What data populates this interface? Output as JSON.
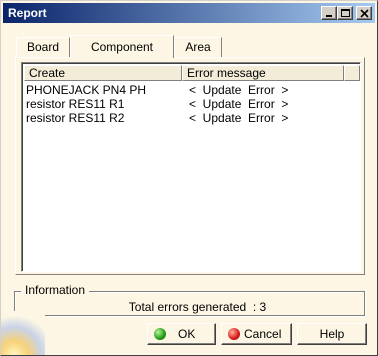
{
  "window": {
    "title": "Report",
    "controls": {
      "minimize_icon": "minimize-icon",
      "maximize_icon": "maximize-icon",
      "close_icon": "close-icon"
    }
  },
  "tabs": [
    {
      "label": "Board",
      "selected": false
    },
    {
      "label": "Component",
      "selected": true
    },
    {
      "label": "Area",
      "selected": false
    }
  ],
  "list": {
    "columns": [
      "Create",
      "Error message"
    ],
    "rows": [
      {
        "create": "PHONEJACK PN4 PH",
        "error": "<  Update  Error  >"
      },
      {
        "create": "resistor RES11 R1",
        "error": "<  Update  Error  >"
      },
      {
        "create": "resistor RES11 R2",
        "error": "<  Update  Error  >"
      }
    ]
  },
  "information": {
    "legend": "Information",
    "text": "Total errors generated  : 3"
  },
  "buttons": {
    "ok": "OK",
    "cancel": "Cancel",
    "help": "Help"
  },
  "colors": {
    "dialog_background": "#fdf6e4",
    "title_bar": "#0a246a",
    "ok_icon": "#1f9a10",
    "cancel_icon": "#d81818"
  }
}
